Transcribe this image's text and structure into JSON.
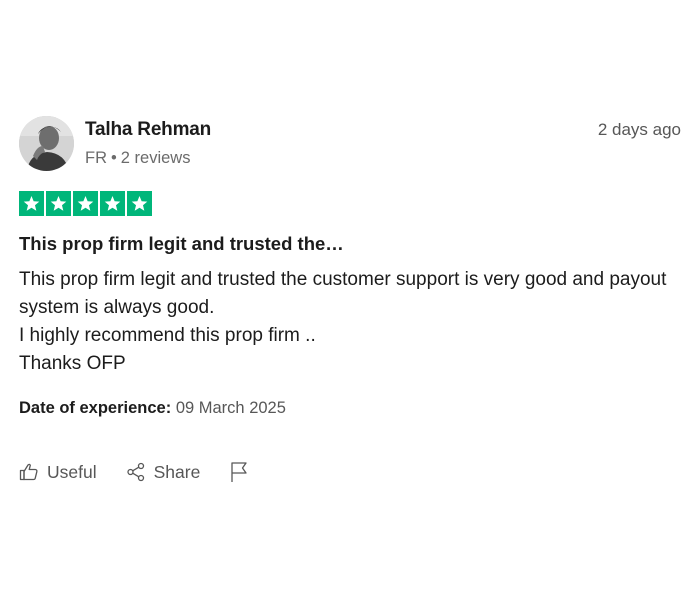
{
  "reviewer": {
    "name": "Talha Rehman",
    "country": "FR",
    "separator": "•",
    "reviews_count": "2 reviews"
  },
  "review": {
    "posted": "2 days ago",
    "rating": 5,
    "rating_max": 5,
    "title": "This prop firm legit and trusted the…",
    "body_lines": [
      "This prop firm legit and trusted the customer support is very good and payout system is always good.",
      "I highly recommend this prop firm ..",
      "Thanks OFP"
    ],
    "experience_label": "Date of experience:",
    "experience_date": "09 March 2025"
  },
  "actions": {
    "useful_label": "Useful",
    "share_label": "Share",
    "useful_icon": "thumbs-up-icon",
    "share_icon": "share-icon",
    "report_icon": "flag-icon"
  },
  "colors": {
    "star_fill": "#00b67a",
    "text_primary": "#1c1c1c",
    "text_secondary": "#575757"
  }
}
